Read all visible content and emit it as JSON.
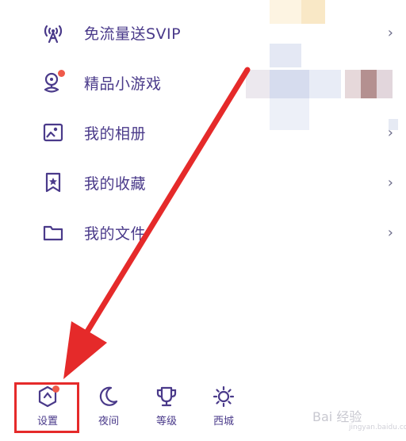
{
  "menu": {
    "items": [
      {
        "label": "免流量送SVIP",
        "icon": "broadcast-icon",
        "chevron": "›"
      },
      {
        "label": "精品小游戏",
        "icon": "game-pin-icon",
        "chevron": ""
      },
      {
        "label": "我的相册",
        "icon": "photo-album-icon",
        "chevron": "›"
      },
      {
        "label": "我的收藏",
        "icon": "bookmark-star-icon",
        "chevron": "›"
      },
      {
        "label": "我的文件",
        "icon": "folder-icon",
        "chevron": "›"
      }
    ]
  },
  "bottom_bar": {
    "tabs": [
      {
        "label": "设置",
        "icon": "settings-hexagon-icon"
      },
      {
        "label": "夜间",
        "icon": "moon-icon"
      },
      {
        "label": "等级",
        "icon": "trophy-icon"
      },
      {
        "label": "西城",
        "icon": "sun-icon"
      }
    ]
  },
  "watermark": {
    "text": "Bai 经验",
    "sub": "jingyan.baidu.com"
  },
  "colors": {
    "icon": "#4a3a8a",
    "badge": "#ef5a4a",
    "annotation": "#e52a2a"
  }
}
